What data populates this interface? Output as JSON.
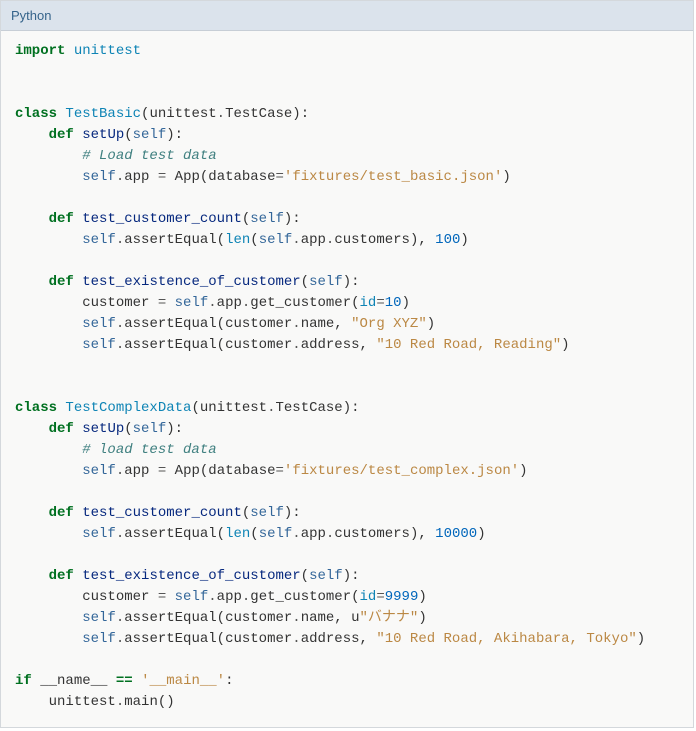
{
  "header": {
    "label": "Python"
  },
  "code": {
    "l1_import": "import",
    "l1_mod": "unittest",
    "l4_class": "class",
    "l4_name": "TestBasic",
    "l4_p1": "(",
    "l4_base1": "unittest",
    "l4_dot": ".",
    "l4_base2": "TestCase",
    "l4_p2": "):",
    "l5_def": "def",
    "l5_fn": "setUp",
    "l5_p1": "(",
    "l5_self": "self",
    "l5_p2": "):",
    "l6_comment": "# Load test data",
    "l7_self": "self",
    "l7_dot1": ".",
    "l7_app": "app",
    "l7_eq": "=",
    "l7_App": "App",
    "l7_p1": "(",
    "l7_kw": "database",
    "l7_eq2": "=",
    "l7_str": "'fixtures/test_basic.json'",
    "l7_p2": ")",
    "l9_def": "def",
    "l9_fn": "test_customer_count",
    "l9_p1": "(",
    "l9_self": "self",
    "l9_p2": "):",
    "l10_self1": "self",
    "l10_dot1": ".",
    "l10_assert": "assertEqual",
    "l10_p1": "(",
    "l10_len": "len",
    "l10_p2": "(",
    "l10_self2": "self",
    "l10_dot2": ".",
    "l10_app": "app",
    "l10_dot3": ".",
    "l10_cust": "customers",
    "l10_p3": "),",
    "l10_num": "100",
    "l10_p4": ")",
    "l12_def": "def",
    "l12_fn": "test_existence_of_customer",
    "l12_p1": "(",
    "l12_self": "self",
    "l12_p2": "):",
    "l13_cust": "customer",
    "l13_eq": "=",
    "l13_self": "self",
    "l13_dot1": ".",
    "l13_app": "app",
    "l13_dot2": ".",
    "l13_get": "get_customer",
    "l13_p1": "(",
    "l13_id": "id",
    "l13_eq2": "=",
    "l13_num": "10",
    "l13_p2": ")",
    "l14_self": "self",
    "l14_dot": ".",
    "l14_assert": "assertEqual",
    "l14_p1": "(",
    "l14_cust": "customer",
    "l14_dot2": ".",
    "l14_name": "name",
    "l14_comma": ",",
    "l14_str": "\"Org XYZ\"",
    "l14_p2": ")",
    "l15_self": "self",
    "l15_dot": ".",
    "l15_assert": "assertEqual",
    "l15_p1": "(",
    "l15_cust": "customer",
    "l15_dot2": ".",
    "l15_addr": "address",
    "l15_comma": ",",
    "l15_str": "\"10 Red Road, Reading\"",
    "l15_p2": ")",
    "l18_class": "class",
    "l18_name": "TestComplexData",
    "l18_p1": "(",
    "l18_base1": "unittest",
    "l18_dot": ".",
    "l18_base2": "TestCase",
    "l18_p2": "):",
    "l19_def": "def",
    "l19_fn": "setUp",
    "l19_p1": "(",
    "l19_self": "self",
    "l19_p2": "):",
    "l20_comment": "# load test data",
    "l21_self": "self",
    "l21_dot1": ".",
    "l21_app": "app",
    "l21_eq": "=",
    "l21_App": "App",
    "l21_p1": "(",
    "l21_kw": "database",
    "l21_eq2": "=",
    "l21_str": "'fixtures/test_complex.json'",
    "l21_p2": ")",
    "l23_def": "def",
    "l23_fn": "test_customer_count",
    "l23_p1": "(",
    "l23_self": "self",
    "l23_p2": "):",
    "l24_self1": "self",
    "l24_dot1": ".",
    "l24_assert": "assertEqual",
    "l24_p1": "(",
    "l24_len": "len",
    "l24_p2": "(",
    "l24_self2": "self",
    "l24_dot2": ".",
    "l24_app": "app",
    "l24_dot3": ".",
    "l24_cust": "customers",
    "l24_p3": "),",
    "l24_num": "10000",
    "l24_p4": ")",
    "l26_def": "def",
    "l26_fn": "test_existence_of_customer",
    "l26_p1": "(",
    "l26_self": "self",
    "l26_p2": "):",
    "l27_cust": "customer",
    "l27_eq": "=",
    "l27_self": "self",
    "l27_dot1": ".",
    "l27_app": "app",
    "l27_dot2": ".",
    "l27_get": "get_customer",
    "l27_p1": "(",
    "l27_id": "id",
    "l27_eq2": "=",
    "l27_num": "9999",
    "l27_p2": ")",
    "l28_self": "self",
    "l28_dot": ".",
    "l28_assert": "assertEqual",
    "l28_p1": "(",
    "l28_cust": "customer",
    "l28_dot2": ".",
    "l28_name": "name",
    "l28_comma": ",",
    "l28_u": "u",
    "l28_str": "\"バナナ\"",
    "l28_p2": ")",
    "l29_self": "self",
    "l29_dot": ".",
    "l29_assert": "assertEqual",
    "l29_p1": "(",
    "l29_cust": "customer",
    "l29_dot2": ".",
    "l29_addr": "address",
    "l29_comma": ",",
    "l29_str": "\"10 Red Road, Akihabara, Tokyo\"",
    "l29_p2": ")",
    "l31_if": "if",
    "l31_name": "__name__",
    "l31_eq": "==",
    "l31_main": "'__main__'",
    "l31_colon": ":",
    "l32_unittest": "unittest",
    "l32_dot": ".",
    "l32_main": "main",
    "l32_p": "()"
  }
}
